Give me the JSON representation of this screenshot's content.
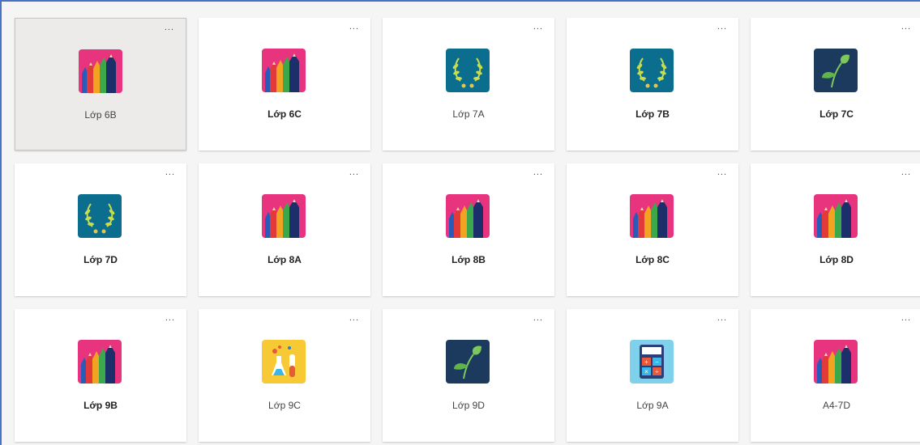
{
  "teams": [
    {
      "name": "Lớp 6B",
      "icon": "pencils-icon",
      "bold": false,
      "selected": true
    },
    {
      "name": "Lớp 6C",
      "icon": "pencils-icon",
      "bold": true,
      "selected": false
    },
    {
      "name": "Lớp 7A",
      "icon": "laurel-icon",
      "bold": false,
      "selected": false
    },
    {
      "name": "Lớp 7B",
      "icon": "laurel-icon",
      "bold": true,
      "selected": false
    },
    {
      "name": "Lớp 7C",
      "icon": "leaf-icon",
      "bold": true,
      "selected": false
    },
    {
      "name": "Lớp 7D",
      "icon": "laurel-icon",
      "bold": true,
      "selected": false
    },
    {
      "name": "Lớp 8A",
      "icon": "pencils-icon",
      "bold": true,
      "selected": false
    },
    {
      "name": "Lớp 8B",
      "icon": "pencils-icon",
      "bold": true,
      "selected": false
    },
    {
      "name": "Lớp 8C",
      "icon": "pencils-icon",
      "bold": true,
      "selected": false
    },
    {
      "name": "Lớp 8D",
      "icon": "pencils-icon",
      "bold": true,
      "selected": false
    },
    {
      "name": "Lớp 9B",
      "icon": "pencils-icon",
      "bold": true,
      "selected": false
    },
    {
      "name": "Lớp 9C",
      "icon": "flask-icon",
      "bold": false,
      "selected": false
    },
    {
      "name": "Lớp 9D",
      "icon": "leaf-icon",
      "bold": false,
      "selected": false
    },
    {
      "name": "Lớp 9A",
      "icon": "calculator-icon",
      "bold": false,
      "selected": false
    },
    {
      "name": "A4-7D",
      "icon": "pencils-icon",
      "bold": false,
      "selected": false
    }
  ],
  "more_options_label": "...",
  "colors": {
    "accent_border": "#4a72c4"
  }
}
